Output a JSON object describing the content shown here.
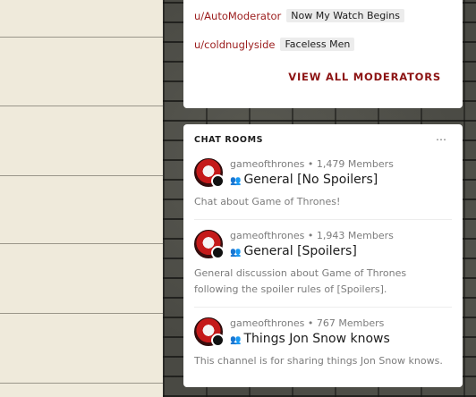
{
  "moderators": [
    {
      "username": "u/AutoModerator",
      "flair": "Now My Watch Begins"
    },
    {
      "username": "u/coldnuglyside",
      "flair": "Faceless Men"
    }
  ],
  "view_all_label": "VIEW ALL MODERATORS",
  "chat_rooms": {
    "title": "CHAT ROOMS",
    "more_icon": "⋯",
    "rooms": [
      {
        "community": "gameofthrones",
        "members": "• 1,479 Members",
        "name": "General [No Spoilers]",
        "description": "Chat about Game of Thrones!"
      },
      {
        "community": "gameofthrones",
        "members": "• 1,943 Members",
        "name": "General [Spoilers]",
        "description": "General discussion about Game of Thrones following the spoiler rules of [Spoilers]."
      },
      {
        "community": "gameofthrones",
        "members": "• 767 Members",
        "name": "Things Jon Snow knows",
        "description": "This channel is for sharing things Jon Snow knows."
      }
    ]
  },
  "colors": {
    "accent": "#8c1313",
    "username": "#9b1c1c"
  }
}
